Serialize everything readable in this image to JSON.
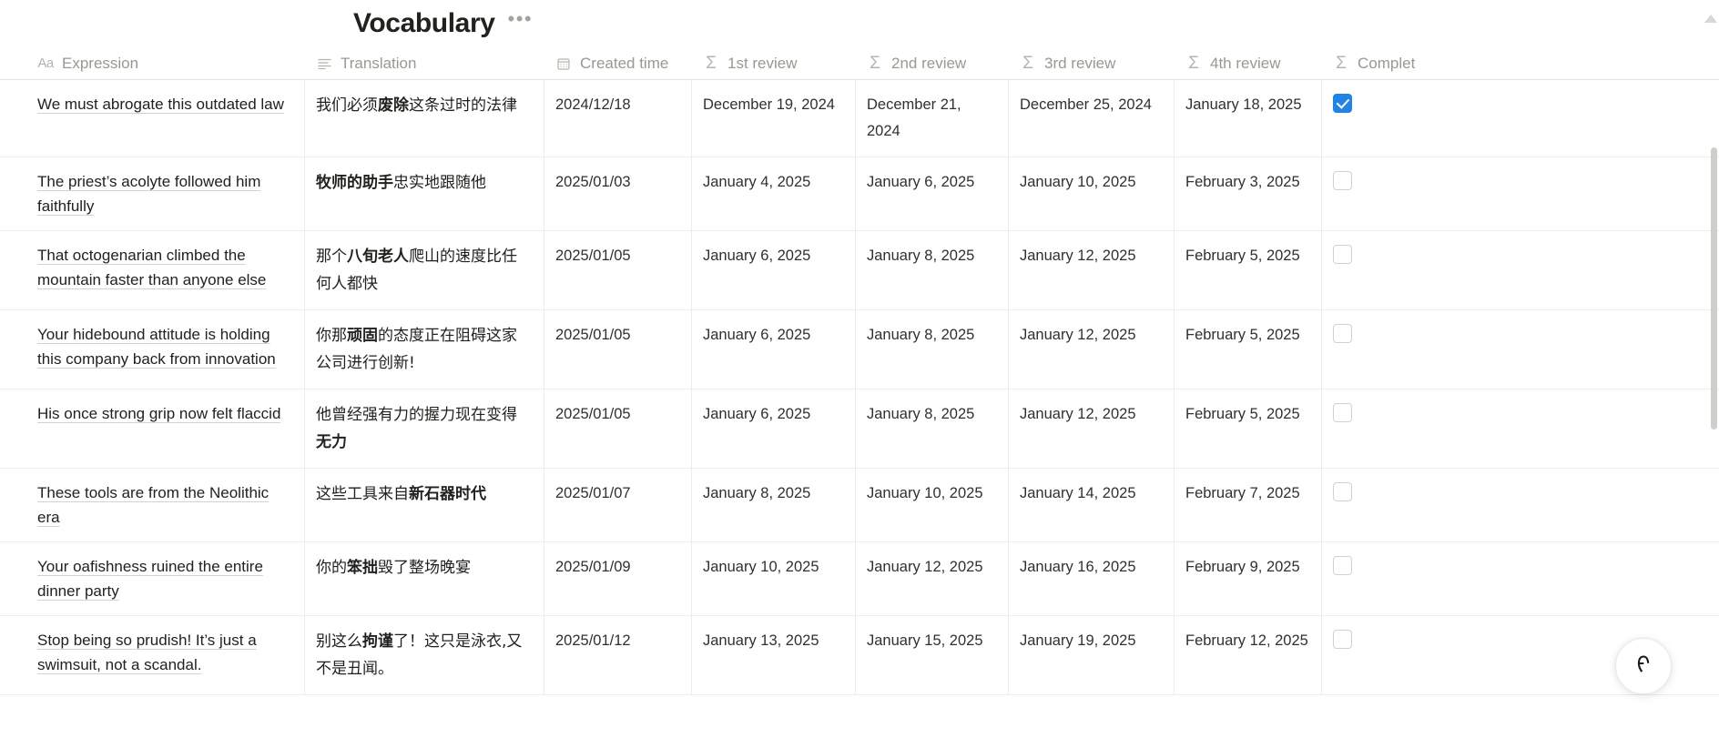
{
  "header": {
    "title": "Vocabulary",
    "more_label": "•••"
  },
  "columns": [
    {
      "key": "expression",
      "label": "Expression",
      "icon": "text-icon",
      "glyph": "Aa"
    },
    {
      "key": "translation",
      "label": "Translation",
      "icon": "lines-icon",
      "glyph": ""
    },
    {
      "key": "created",
      "label": "Created time",
      "icon": "calendar-icon",
      "glyph": ""
    },
    {
      "key": "review1",
      "label": "1st review",
      "icon": "formula-icon",
      "glyph": "Σ"
    },
    {
      "key": "review2",
      "label": "2nd review",
      "icon": "formula-icon",
      "glyph": "Σ"
    },
    {
      "key": "review3",
      "label": "3rd review",
      "icon": "formula-icon",
      "glyph": "Σ"
    },
    {
      "key": "review4",
      "label": "4th review",
      "icon": "formula-icon",
      "glyph": "Σ"
    },
    {
      "key": "completed",
      "label": "Complet",
      "icon": "formula-icon",
      "glyph": "Σ"
    }
  ],
  "rows": [
    {
      "expression": "We must abrogate this outdated law",
      "translation_pre": "我们必须",
      "translation_bold": "废除",
      "translation_post": "这条过时的法律",
      "created": "2024/12/18",
      "review1": "December 19, 2024",
      "review2": "December 21, 2024",
      "review3": "December 25, 2024",
      "review4": "January 18, 2025",
      "completed": true
    },
    {
      "expression": "The priest’s acolyte followed him faithfully",
      "translation_pre": "",
      "translation_bold": "牧师的助手",
      "translation_post": "忠实地跟随他",
      "created": "2025/01/03",
      "review1": "January 4, 2025",
      "review2": "January 6, 2025",
      "review3": "January 10, 2025",
      "review4": "February 3, 2025",
      "completed": false
    },
    {
      "expression": "That octogenarian climbed the mountain faster than anyone else",
      "translation_pre": "那个",
      "translation_bold": "八旬老人",
      "translation_post": "爬山的速度比任何人都快",
      "created": "2025/01/05",
      "review1": "January 6, 2025",
      "review2": "January 8, 2025",
      "review3": "January 12, 2025",
      "review4": "February 5, 2025",
      "completed": false
    },
    {
      "expression": "Your hidebound attitude is holding this company back from innovation",
      "translation_pre": "你那",
      "translation_bold": "顽固",
      "translation_post": "的态度正在阻碍这家公司进行创新!",
      "created": "2025/01/05",
      "review1": "January 6, 2025",
      "review2": "January 8, 2025",
      "review3": "January 12, 2025",
      "review4": "February 5, 2025",
      "completed": false
    },
    {
      "expression": "His once strong grip now felt flaccid",
      "translation_pre": "他曾经强有力的握力现在变得",
      "translation_bold": "无力",
      "translation_post": "",
      "created": "2025/01/05",
      "review1": "January 6, 2025",
      "review2": "January 8, 2025",
      "review3": "January 12, 2025",
      "review4": "February 5, 2025",
      "completed": false
    },
    {
      "expression": "These tools are from the Neolithic era",
      "translation_pre": "这些工具来自",
      "translation_bold": "新石器时代",
      "translation_post": "",
      "created": "2025/01/07",
      "review1": "January 8, 2025",
      "review2": "January 10, 2025",
      "review3": "January 14, 2025",
      "review4": "February 7, 2025",
      "completed": false
    },
    {
      "expression": "Your oafishness ruined the entire dinner party",
      "translation_pre": "你的",
      "translation_bold": "笨拙",
      "translation_post": "毁了整场晚宴",
      "created": "2025/01/09",
      "review1": "January 10, 2025",
      "review2": "January 12, 2025",
      "review3": "January 16, 2025",
      "review4": "February 9, 2025",
      "completed": false
    },
    {
      "expression": "Stop being so prudish! It’s just a swimsuit, not a scandal.",
      "translation_pre": "别这么",
      "translation_bold": "拘谨",
      "translation_post": "了！这只是泳衣,又不是丑闻。",
      "created": "2025/01/12",
      "review1": "January 13, 2025",
      "review2": "January 15, 2025",
      "review3": "January 19, 2025",
      "review4": "February 12, 2025",
      "completed": false
    }
  ],
  "ai_button": {
    "label": "ᠻ",
    "name": "notion-ai"
  },
  "colors": {
    "accent": "#2383e2",
    "text": "#23211e",
    "muted": "#9b9890",
    "border": "#edece9"
  }
}
